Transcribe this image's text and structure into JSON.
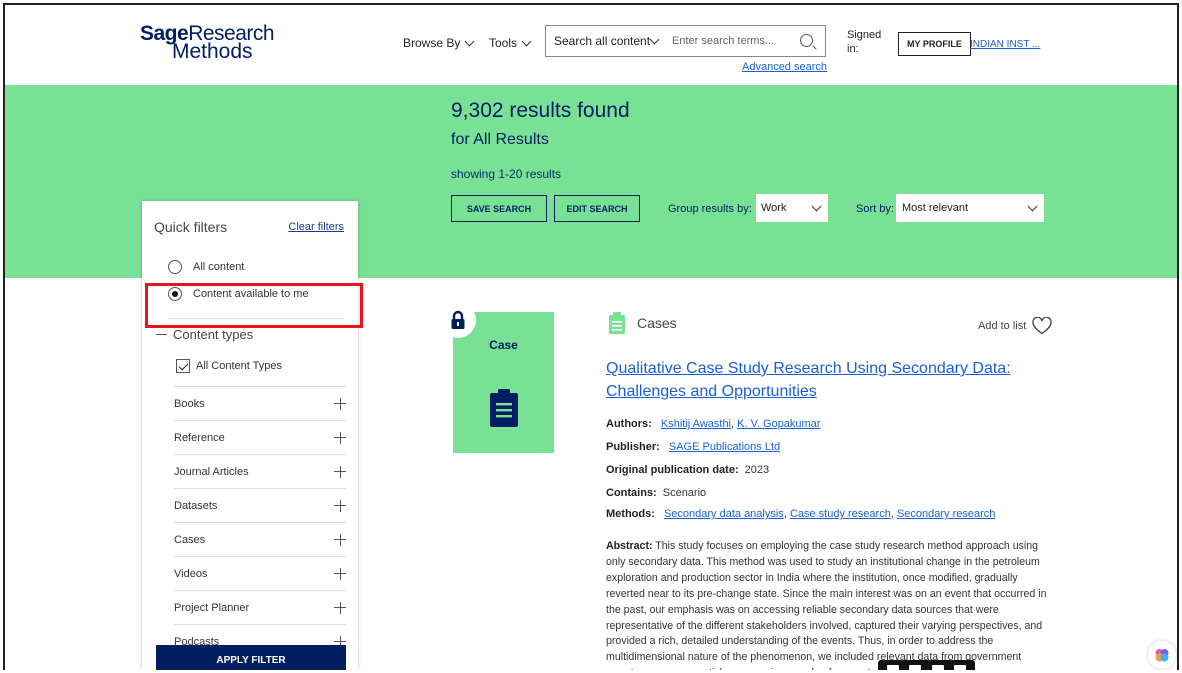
{
  "header": {
    "logo_line1_bold": "Sage",
    "logo_line1_rest": "Research",
    "logo_line2": "Methods",
    "browse_by": "Browse By",
    "tools": "Tools",
    "search_scope": "Search all content",
    "search_placeholder": "Enter search terms...",
    "advanced_search": "Advanced search",
    "signed_in": "Signed in:",
    "my_profile": "MY PROFILE",
    "institution": "INDIAN INST ..."
  },
  "banner": {
    "results_count": "9,302 results found",
    "results_for": "for All Results",
    "showing": "showing 1-20 results",
    "save_search": "SAVE SEARCH",
    "edit_search": "EDIT SEARCH",
    "group_label": "Group results by:",
    "group_value": "Work",
    "sort_label": "Sort by:",
    "sort_value": "Most relevant",
    "background_color": "#79e196"
  },
  "sidebar": {
    "title": "Quick filters",
    "clear_filters": "Clear filters",
    "radio_all": "All content",
    "radio_available": "Content available to me",
    "content_types_header": "Content types",
    "all_content_types": "All Content Types",
    "content_types": [
      {
        "label": "Books"
      },
      {
        "label": "Reference"
      },
      {
        "label": "Journal Articles"
      },
      {
        "label": "Datasets"
      },
      {
        "label": "Cases"
      },
      {
        "label": "Videos"
      },
      {
        "label": "Project Planner"
      },
      {
        "label": "Podcasts"
      }
    ],
    "apply_filter": "APPLY FILTER"
  },
  "result": {
    "thumb_label": "Case",
    "type": "Cases",
    "add_to_list": "Add to list",
    "title": "Qualitative Case Study Research Using Secondary Data: Challenges and Opportunities",
    "authors_label": "Authors:",
    "author1": "Kshitij Awasthi",
    "author2": "K. V. Gopakumar",
    "publisher_label": "Publisher:",
    "publisher": "SAGE Publications Ltd",
    "date_label": "Original publication date:",
    "date": "2023",
    "contains_label": "Contains:",
    "contains": "Scenario",
    "methods_label": "Methods:",
    "method1": "Secondary data analysis",
    "method2": "Case study research",
    "method3": "Secondary research",
    "abstract_label": "Abstract:",
    "abstract": "This study focuses on employing the case study research method approach using only secondary data. This method was used to study an institutional change in the petroleum exploration and production sector in India where the institution, once modified, gradually reverted near to its pre-change state. Since the main interest was on an event that occurred in the past, our emphasis was on accessing reliable secondary data sources that were representative of the different stakeholders involved, captured their varying perspectives, and provided a rich, detailed understanding of the events. Thus, in order to address the multidimensional nature of the phenomenon, we included relevant data from government reports, newspaper articles, magazines, and ... for our study"
  },
  "colors": {
    "brand_navy": "#001e60",
    "link_blue": "#1a5fd6",
    "highlight_red": "#e8151b"
  }
}
